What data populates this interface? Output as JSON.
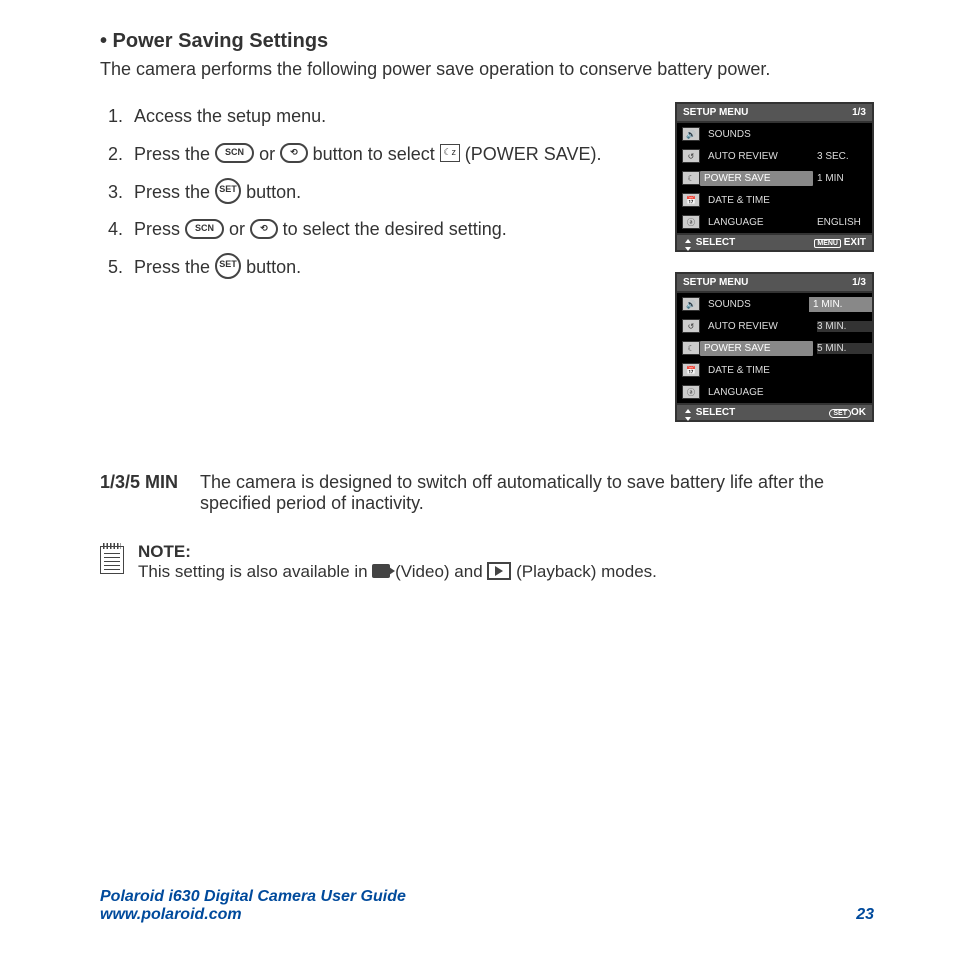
{
  "heading": "• Power Saving Settings",
  "intro": "The camera performs the following power save operation to conserve battery power.",
  "steps": {
    "s1": "Access the setup menu.",
    "s2a": "Press the ",
    "s2b": " or ",
    "s2c": " button to select ",
    "s2d": " (POWER SAVE).",
    "s3a": "Press the ",
    "s3b": " button.",
    "s4a": "Press ",
    "s4b": " or ",
    "s4c": " to select the desired setting.",
    "s5a": "Press the ",
    "s5b": " button."
  },
  "icons": {
    "scn": "SCN",
    "timer": "⟲",
    "set": "SET",
    "pz": "☾z"
  },
  "screen1": {
    "title": "SETUP MENU",
    "page": "1/3",
    "rows": [
      {
        "label": "SOUNDS",
        "value": ""
      },
      {
        "label": "AUTO REVIEW",
        "value": "3 SEC."
      },
      {
        "label": "POWER SAVE",
        "value": "1 MIN",
        "hl": true
      },
      {
        "label": "DATE & TIME",
        "value": ""
      },
      {
        "label": "LANGUAGE",
        "value": "ENGLISH"
      }
    ],
    "footerL": "SELECT",
    "footerR": "EXIT",
    "footerRIcon": "MENU"
  },
  "screen2": {
    "title": "SETUP MENU",
    "page": "1/3",
    "rows": [
      {
        "label": "SOUNDS",
        "value": "1 MIN.",
        "vhl": true
      },
      {
        "label": "AUTO REVIEW",
        "value": "3 MIN."
      },
      {
        "label": "POWER SAVE",
        "value": "5 MIN.",
        "hl": true
      },
      {
        "label": "DATE & TIME",
        "value": ""
      },
      {
        "label": "LANGUAGE",
        "value": ""
      }
    ],
    "footerL": "SELECT",
    "footerR": "OK",
    "footerRIcon": "SET"
  },
  "def": {
    "term": "1/3/5 MIN",
    "text": "The camera is designed to switch off automatically to save battery life after the specified period of inactivity."
  },
  "note": {
    "label": "NOTE:",
    "t1": "This setting is also available in ",
    "t2": " (Video) and ",
    "t3": " (Playback) modes."
  },
  "footer": {
    "guide": "Polaroid i630 Digital Camera User Guide",
    "url": "www.polaroid.com",
    "page": "23"
  }
}
